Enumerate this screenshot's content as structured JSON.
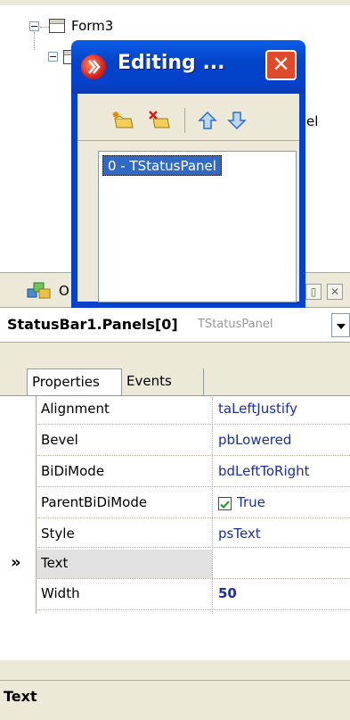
{
  "tree": {
    "root_label": "Form3",
    "hidden_label_fragment": "el"
  },
  "inspector": {
    "tab_label_fragment": "O",
    "object_name": "StatusBar1.Panels[0]",
    "object_type": "TStatusPanel",
    "tabs": [
      {
        "label": "Properties",
        "active": true
      },
      {
        "label": "Events",
        "active": false
      }
    ],
    "properties": [
      {
        "name": "Alignment",
        "value": "taLeftJustify",
        "bold": false,
        "checkbox": false
      },
      {
        "name": "Bevel",
        "value": "pbLowered",
        "bold": false,
        "checkbox": false
      },
      {
        "name": "BiDiMode",
        "value": "bdLeftToRight",
        "bold": false,
        "checkbox": false
      },
      {
        "name": "ParentBiDiMode",
        "value": "True",
        "bold": false,
        "checkbox": true
      },
      {
        "name": "Style",
        "value": "psText",
        "bold": false,
        "checkbox": false
      },
      {
        "name": "Text",
        "value": "",
        "bold": false,
        "checkbox": false,
        "selected": true
      },
      {
        "name": "Width",
        "value": "50",
        "bold": true,
        "checkbox": false
      }
    ],
    "selected_marker": "»",
    "status_text": "Text"
  },
  "editor": {
    "title": "Editing ...",
    "close_glyph": "✕",
    "toolbar": [
      {
        "icon": "add-new-icon"
      },
      {
        "icon": "delete-icon"
      },
      {
        "icon": "move-up-icon"
      },
      {
        "icon": "move-down-icon"
      }
    ],
    "items": [
      "0 - TStatusPanel"
    ]
  },
  "colors": {
    "title_blue": "#0442cc",
    "value_blue": "#1c2ea0",
    "selection_blue": "#316ac5",
    "close_red": "#e04a2c"
  }
}
